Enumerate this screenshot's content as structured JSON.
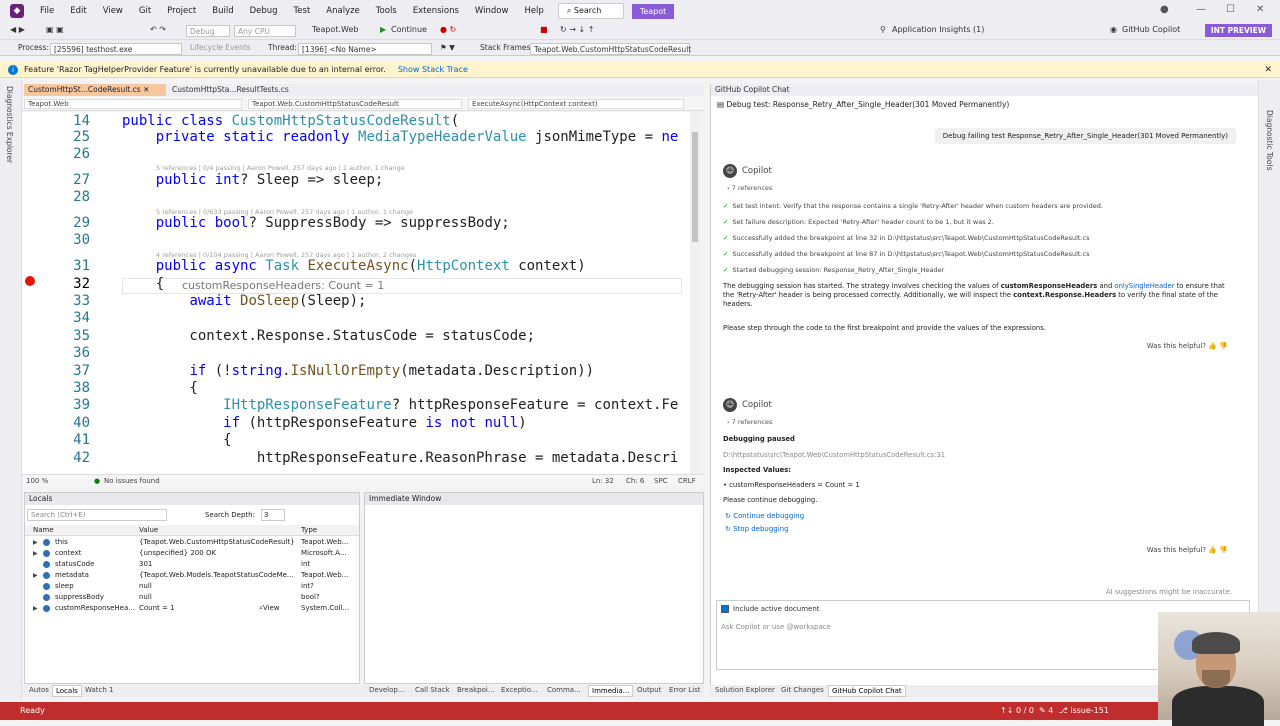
{
  "menu": {
    "items": [
      "File",
      "Edit",
      "View",
      "Git",
      "Project",
      "Build",
      "Debug",
      "Test",
      "Analyze",
      "Tools",
      "Extensions",
      "Window",
      "Help"
    ],
    "search": "Search",
    "solution": "Teapot"
  },
  "toolbar": {
    "config": "Debug",
    "platform": "Any CPU",
    "startup": "Teapot.Web",
    "continue": "Continue",
    "insights": "Application Insights (1)",
    "copilot": "GitHub Copilot",
    "int_preview": "INT PREVIEW"
  },
  "debugbar": {
    "process_label": "Process:",
    "process_value": "[25596] testhost.exe",
    "lifecycle": "Lifecycle Events",
    "thread_label": "Thread:",
    "thread_value": "[1396] <No Name>",
    "stack_label": "Stack Frames:",
    "stack_value": "Teapot.Web.CustomHttpStatusCodeResult"
  },
  "infobar": {
    "message": "Feature 'Razor TagHelperProvider Feature' is currently unavailable due to an internal error.",
    "link": "Show Stack Trace"
  },
  "left_strip": "Diagnostics Explorer",
  "right_strip": "Diagnostic Tools",
  "editor": {
    "tabs": [
      "CustomHttpSt...CodeResult.cs",
      "CustomHttpSta...ResultTests.cs"
    ],
    "nav": [
      "Teapot.Web",
      "Teapot.Web.CustomHttpStatusCodeResult",
      "ExecuteAsync(HttpContext context)"
    ],
    "lines": [
      {
        "n": "14",
        "text": "public class CustomHttpStatusCodeResult("
      },
      {
        "n": "25",
        "text": "    private static readonly MediaTypeHeaderValue jsonMimeType = ne"
      },
      {
        "n": "26",
        "text": ""
      },
      {
        "n": "27",
        "text": "    public int? Sleep => sleep;"
      },
      {
        "n": "28",
        "text": ""
      },
      {
        "n": "29",
        "text": "    public bool? SuppressBody => suppressBody;"
      },
      {
        "n": "30",
        "text": ""
      },
      {
        "n": "31",
        "text": "    public async Task ExecuteAsync(HttpContext context)"
      },
      {
        "n": "32",
        "text": "    {"
      },
      {
        "n": "33",
        "text": "        await DoSleep(Sleep);"
      },
      {
        "n": "34",
        "text": ""
      },
      {
        "n": "35",
        "text": "        context.Response.StatusCode = statusCode;"
      },
      {
        "n": "36",
        "text": ""
      },
      {
        "n": "37",
        "text": "        if (!string.IsNullOrEmpty(metadata.Description))"
      },
      {
        "n": "38",
        "text": "        {"
      },
      {
        "n": "39",
        "text": "            IHttpResponseFeature? httpResponseFeature = context.Fe"
      },
      {
        "n": "40",
        "text": "            if (httpResponseFeature is not null)"
      },
      {
        "n": "41",
        "text": "            {"
      },
      {
        "n": "42",
        "text": "                httpResponseFeature.ReasonPhrase = metadata.Descri"
      }
    ],
    "hints": [
      "5 references | 0/4 passing | Aaron Powell, 257 days ago | 1 author, 1 change",
      "5 references | 0/633 passing | Aaron Powell, 257 days ago | 1 author, 1 change",
      "4 references | 0/104 passing | Aaron Powell, 257 days ago | 1 author, 2 changes"
    ],
    "datatip": "customResponseHeaders: Count = 1",
    "status": {
      "zoom": "100 %",
      "issues": "No issues found",
      "position": "Ln: 32",
      "col": "Ch: 6",
      "spc": "SPC",
      "crlf": "CRLF"
    }
  },
  "locals": {
    "title": "Locals",
    "search_placeholder": "Search (Ctrl+E)",
    "depth_label": "Search Depth:",
    "depth_value": "3",
    "columns": [
      "Name",
      "Value",
      "Type"
    ],
    "rows": [
      {
        "name": "this",
        "value": "{Teapot.Web.CustomHttpStatusCodeResult}",
        "type": "Teapot.Web..."
      },
      {
        "name": "context",
        "value": "{unspecified} 200 OK",
        "type": "Microsoft.A..."
      },
      {
        "name": "statusCode",
        "value": "301",
        "type": "int"
      },
      {
        "name": "metadata",
        "value": "{Teapot.Web.Models.TeapotStatusCodeMe...",
        "type": "Teapot.Web..."
      },
      {
        "name": "sleep",
        "value": "null",
        "type": "int?"
      },
      {
        "name": "suppressBody",
        "value": "null",
        "type": "bool?"
      },
      {
        "name": "customResponseHea...",
        "value": "Count = 1",
        "type": "System.Coll..."
      }
    ],
    "view_label": "View"
  },
  "immediate": {
    "title": "Immediate Window"
  },
  "bottom_tabs": [
    "Autos",
    "Locals",
    "Watch 1",
    "Develop...",
    "Call Stack",
    "Breakpoi...",
    "Exceptio...",
    "Comma...",
    "Immedia...",
    "Output",
    "Error List"
  ],
  "chat": {
    "title": "GitHub Copilot Chat",
    "thread": "Debug test: Response_Retry_After_Single_Header(301 Moved Permanently)",
    "user_message": "Debug failing test Response_Retry_After_Single_Header(301 Moved Permanently)",
    "copilot_name": "Copilot",
    "refs1": "7 references",
    "steps": [
      "Set test intent: Verify that the response contains a single 'Retry-After' header when custom headers are provided.",
      "Set failure description: Expected 'Retry-After' header count to be 1, but it was 2.",
      "Successfully added the breakpoint at line 32 in D:\\httpstatus\\src\\Teapot.Web\\CustomHttpStatusCodeResult.cs",
      "Successfully added the breakpoint at line 87 in D:\\httpstatus\\src\\Teapot.Web\\CustomHttpStatusCodeResult.cs",
      "Started debugging session: Response_Retry_After_Single_Header"
    ],
    "summary_pre": "The debugging session has started. The strategy involves checking the values of ",
    "summary_b1": "customResponseHeaders",
    "summary_mid": " and ",
    "summary_l1": "onlySingleHeader",
    "summary_post": " to ensure that the 'Retry-After' header is being processed correctly. Additionally, we will inspect the ",
    "summary_b2": "context.Response.Headers",
    "summary_end": " to verify the final state of the headers.",
    "instruction": "Please step through the code to the first breakpoint and provide the values of the expressions.",
    "helpful": "Was this helpful?",
    "refs2": "7 references",
    "paused_title": "Debugging paused",
    "paused_file": "D:\\httpstatus\\src\\Teapot.Web\\CustomHttpStatusCodeResult.cs:31",
    "inspected_title": "Inspected Values:",
    "inspected_value": "customResponseHeaders = Count = 1",
    "continue_text": "Please continue debugging.",
    "continue_link": "Continue debugging",
    "stop_link": "Stop debugging",
    "disclaimer": "AI suggestions might be inaccurate.",
    "include_doc": "Include active document",
    "input_placeholder": "Ask Copilot or use @workspace"
  },
  "chat_tabs": [
    "Solution Explorer",
    "Git Changes",
    "GitHub Copilot Chat"
  ],
  "status": {
    "ready": "Ready",
    "counts": "0 / 0",
    "branch": "issue-151",
    "pending": "4"
  }
}
